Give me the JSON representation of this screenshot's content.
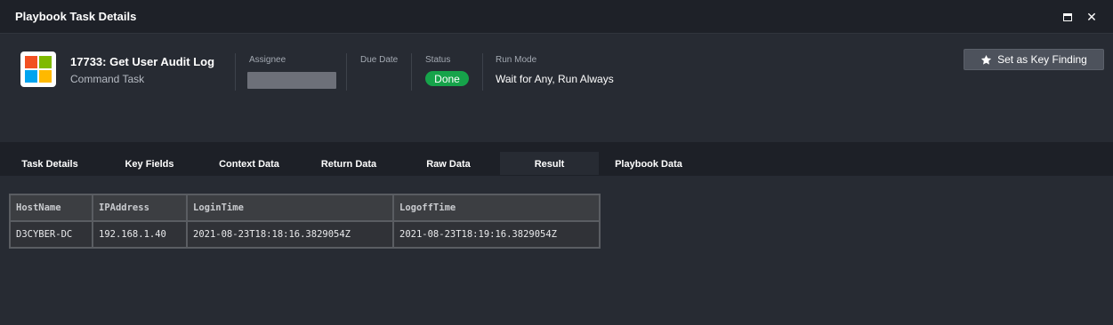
{
  "window": {
    "title": "Playbook Task Details",
    "maximize_icon": "maximize-icon",
    "close_icon": "close-icon",
    "close_glyph": "✕"
  },
  "task": {
    "title": "17733: Get User Audit Log",
    "type": "Command Task",
    "logo_icon": "microsoft-logo-icon",
    "logo_colors": [
      "#f25022",
      "#7fba00",
      "#00a4ef",
      "#ffb900"
    ]
  },
  "fields": {
    "assignee_label": "Assignee",
    "due_date_label": "Due Date",
    "status_label": "Status",
    "status_value": "Done",
    "status_color": "#16a34a",
    "run_mode_label": "Run Mode",
    "run_mode_value": "Wait for Any, Run Always"
  },
  "actions": {
    "key_finding_label": "Set as Key Finding",
    "key_finding_icon": "star-icon"
  },
  "tabs": [
    {
      "label": "Task Details"
    },
    {
      "label": "Key Fields"
    },
    {
      "label": "Context Data"
    },
    {
      "label": "Return Data"
    },
    {
      "label": "Raw Data"
    },
    {
      "label": "Result",
      "active": true
    },
    {
      "label": "Playbook Data"
    }
  ],
  "result_table": {
    "headers": [
      "HostName",
      "IPAddress",
      "LoginTime",
      "LogoffTime"
    ],
    "rows": [
      [
        "D3CYBER-DC",
        "192.168.1.40",
        "2021-08-23T18:18:16.3829054Z",
        "2021-08-23T18:19:16.3829054Z"
      ]
    ]
  }
}
